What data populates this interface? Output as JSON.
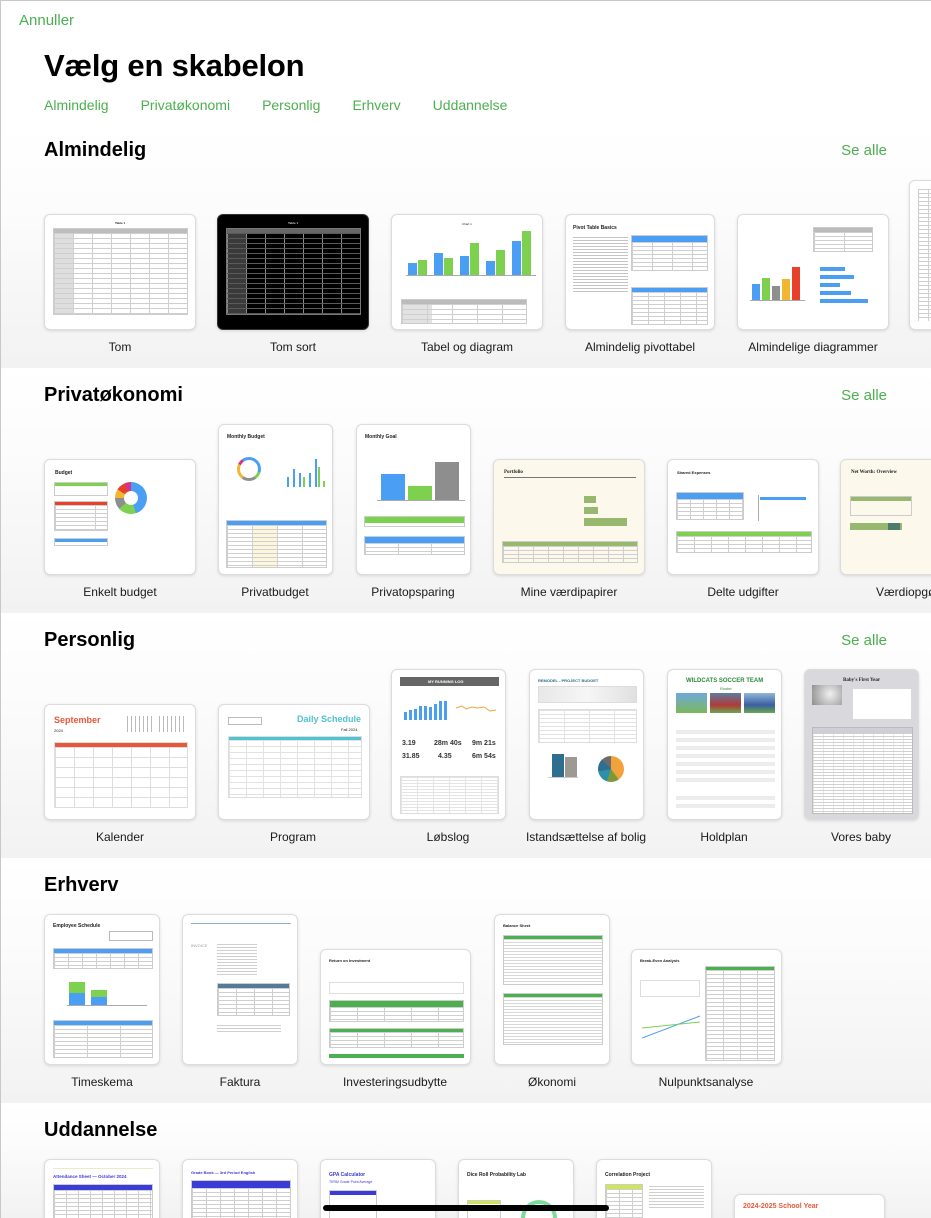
{
  "header": {
    "cancel_label": "Annuller",
    "title": "Vælg en skabelon",
    "nav": [
      "Almindelig",
      "Privatøkonomi",
      "Personlig",
      "Erhverv",
      "Uddannelse"
    ]
  },
  "colors": {
    "accent": "#4caf50",
    "text": "#000000",
    "section_bottom": "#f2f2f2"
  },
  "sections": [
    {
      "title": "Almindelig",
      "see_all": "Se alle",
      "templates": [
        {
          "label": "Tom",
          "preview_title": "Table 1"
        },
        {
          "label": "Tom sort",
          "preview_title": "Table 1"
        },
        {
          "label": "Tabel og diagram",
          "preview_title": "Chart 1"
        },
        {
          "label": "Almindelig pivottabel",
          "preview_title": "Pivot Table Basics"
        },
        {
          "label": "Almindelige diagrammer",
          "preview_title": "Column Chart"
        }
      ]
    },
    {
      "title": "Privatøkonomi",
      "see_all": "Se alle",
      "templates": [
        {
          "label": "Enkelt budget",
          "preview_title": "Budget"
        },
        {
          "label": "Privatbudget",
          "preview_title": "Monthly Budget"
        },
        {
          "label": "Privatopsparing",
          "preview_title": "Monthly Goal"
        },
        {
          "label": "Mine værdipapirer",
          "preview_title": "Portfolio"
        },
        {
          "label": "Delte udgifter",
          "preview_title": "Shared Expenses"
        },
        {
          "label": "Værdiopgø",
          "preview_title": "Net Worth: Overview"
        }
      ]
    },
    {
      "title": "Personlig",
      "see_all": "Se alle",
      "templates": [
        {
          "label": "Kalender",
          "preview_title": "September",
          "preview_sub": "2024"
        },
        {
          "label": "Program",
          "preview_title": "Daily Schedule",
          "preview_sub": "Fall 2024"
        },
        {
          "label": "Løbslog",
          "preview_title": "MY RUNNING LOG",
          "stats": [
            "3.19",
            "28m 40s",
            "9m 21s",
            "31.85",
            "4.35",
            "6m 54s"
          ]
        },
        {
          "label": "Istandsættelse af bolig",
          "preview_title": "REMODEL - PROJECT BUDGET"
        },
        {
          "label": "Holdplan",
          "preview_title": "WILDCATS SOCCER TEAM",
          "preview_sub": "Roster"
        },
        {
          "label": "Vores baby",
          "preview_title": "Baby's First Year"
        }
      ]
    },
    {
      "title": "Erhverv",
      "templates": [
        {
          "label": "Timeskema",
          "preview_title": "Employee Schedule"
        },
        {
          "label": "Faktura",
          "preview_title": "INVOICE"
        },
        {
          "label": "Investeringsudbytte",
          "preview_title": "Return on Investment"
        },
        {
          "label": "Økonomi",
          "preview_title": "Balance Sheet"
        },
        {
          "label": "Nulpunktsanalyse",
          "preview_title": "Break-Even Analysis"
        }
      ]
    },
    {
      "title": "Uddannelse",
      "templates": [
        {
          "preview_title": "Attendance Sheet — October 2024"
        },
        {
          "preview_title": "Grade Book — 3rd Period English"
        },
        {
          "preview_title": "GPA Calculator",
          "preview_sub": "TERM Grade Point Average"
        },
        {
          "preview_title": "Dice Roll Probability Lab"
        },
        {
          "preview_title": "Correlation Project"
        },
        {
          "preview_title": "2024-2025 School Year"
        }
      ]
    }
  ]
}
